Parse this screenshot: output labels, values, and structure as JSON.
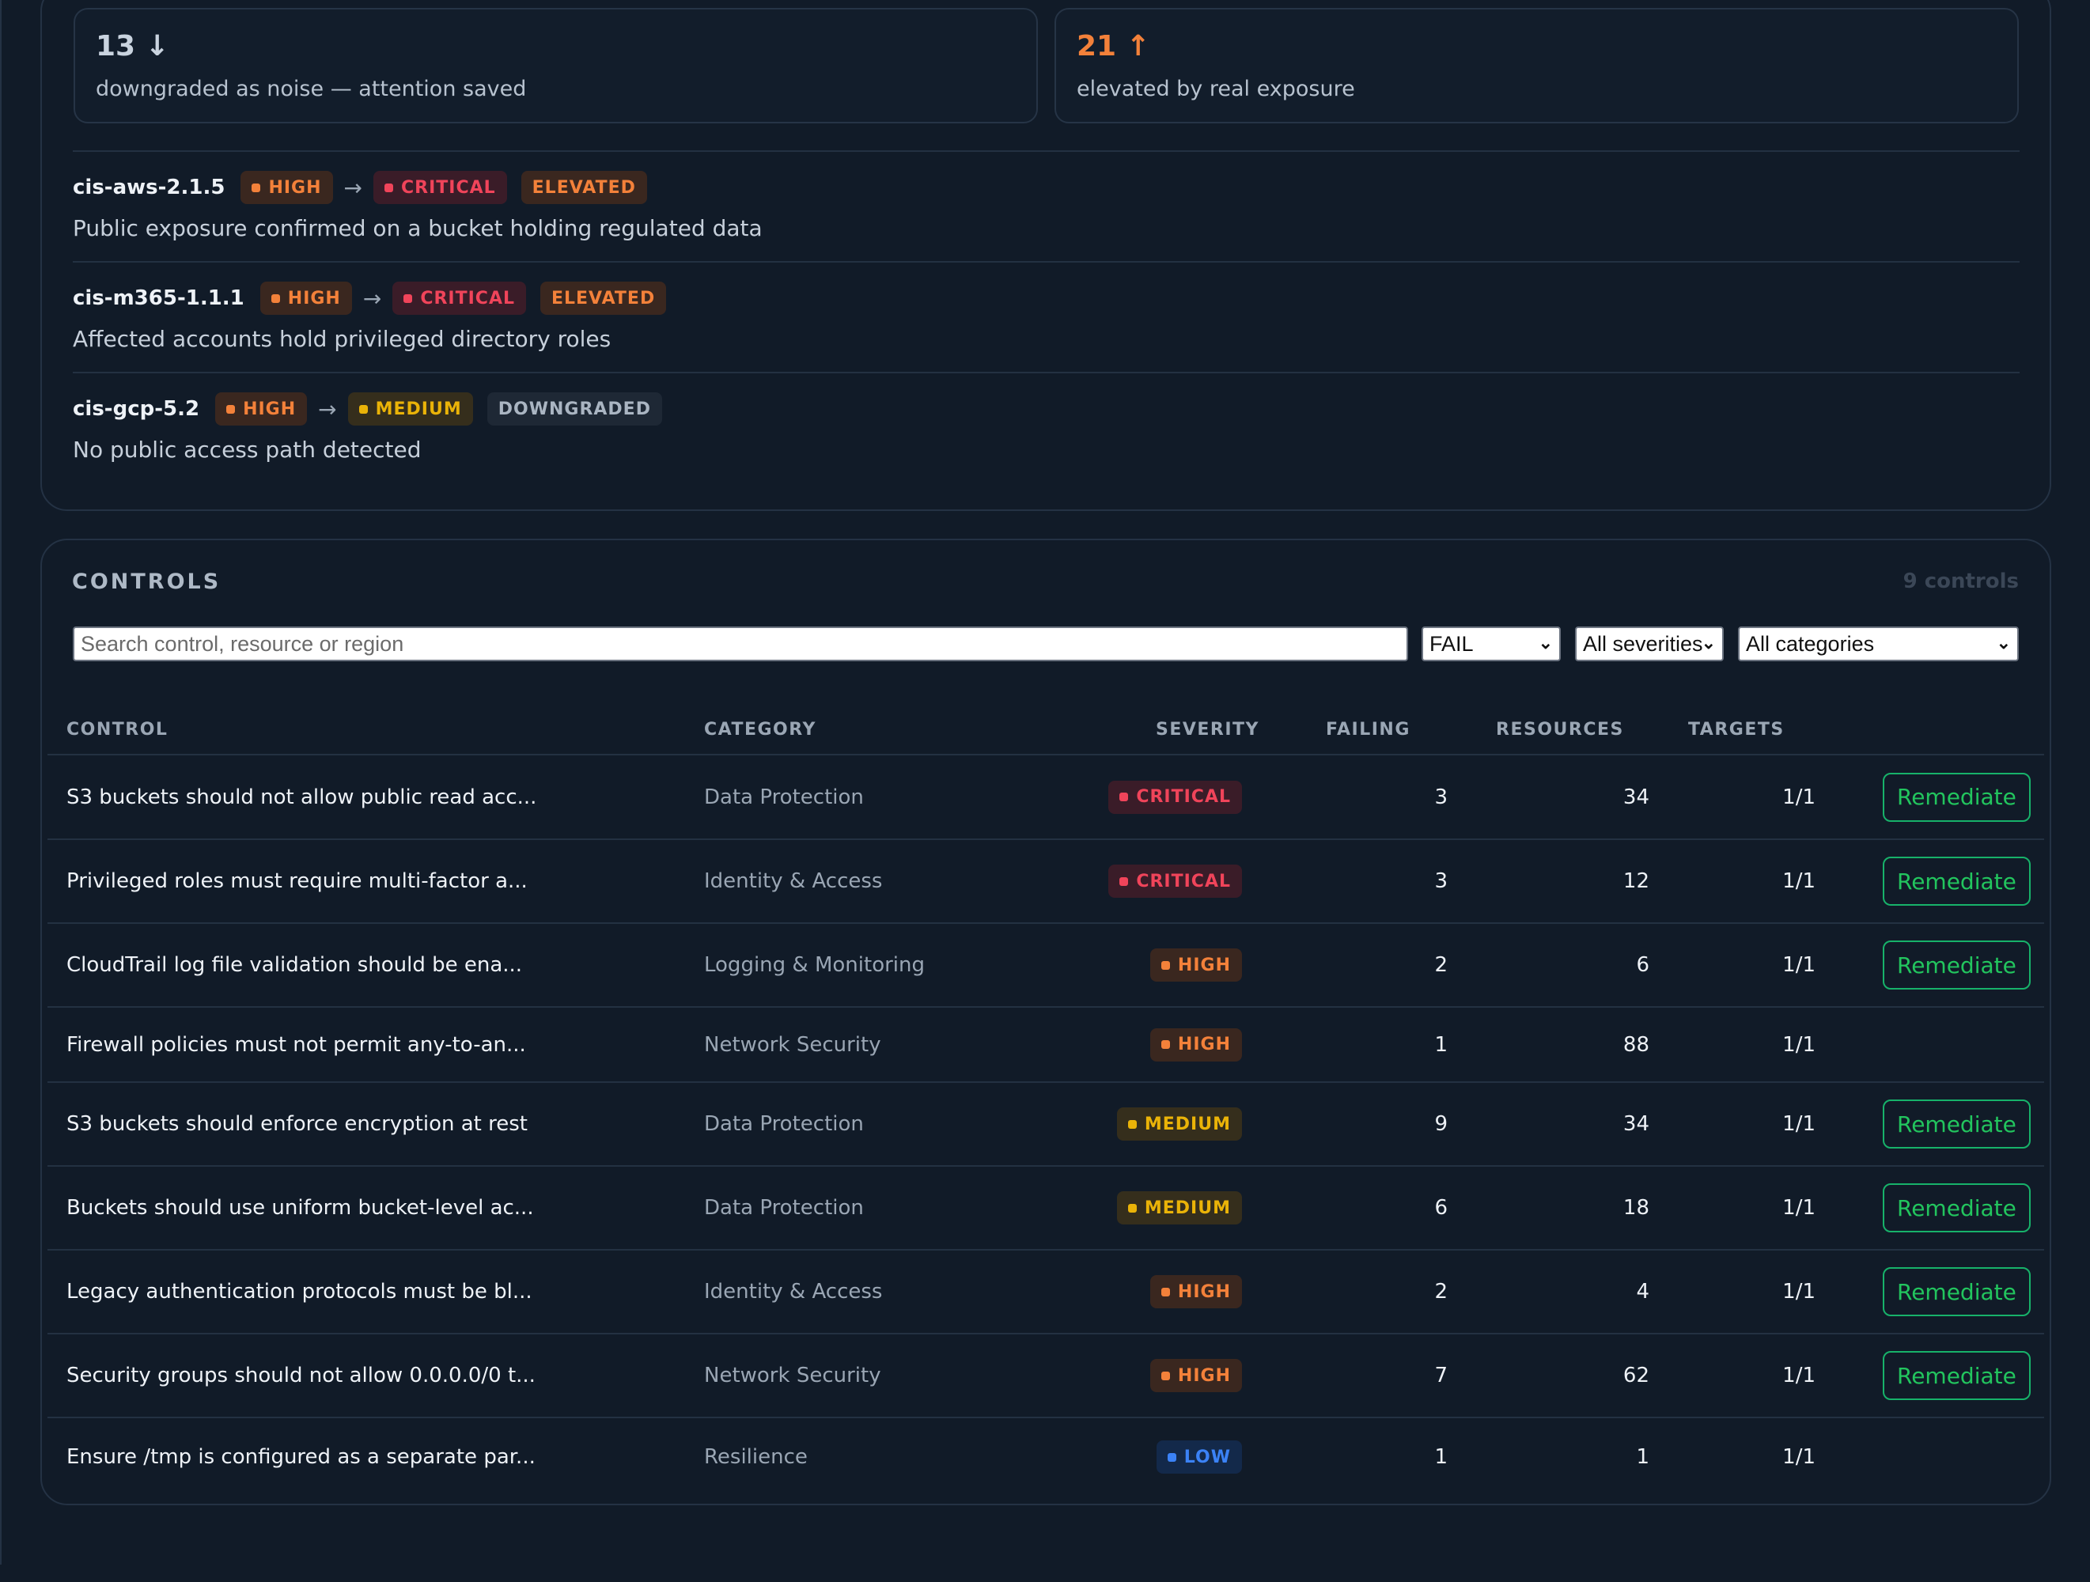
{
  "summary": {
    "downgraded": {
      "value": "13 ↓",
      "label": "downgraded as noise — attention saved"
    },
    "elevated": {
      "value": "21 ↑",
      "label": "elevated by real exposure"
    }
  },
  "adjustments": [
    {
      "id": "cis-aws-2.1.5",
      "from": "HIGH",
      "to": "CRITICAL",
      "change": "ELEVATED",
      "reason": "Public exposure confirmed on a bucket holding regulated data"
    },
    {
      "id": "cis-m365-1.1.1",
      "from": "HIGH",
      "to": "CRITICAL",
      "change": "ELEVATED",
      "reason": "Affected accounts hold privileged directory roles"
    },
    {
      "id": "cis-gcp-5.2",
      "from": "HIGH",
      "to": "MEDIUM",
      "change": "DOWNGRADED",
      "reason": "No public access path detected"
    }
  ],
  "arrow": "→",
  "controls": {
    "title": "CONTROLS",
    "count": "9 controls",
    "search_placeholder": "Search control, resource or region",
    "filters": {
      "status": "FAIL",
      "severity": "All severities",
      "category": "All categories"
    },
    "columns": {
      "control": "CONTROL",
      "category": "CATEGORY",
      "severity": "SEVERITY",
      "failing": "FAILING",
      "resources": "RESOURCES",
      "targets": "TARGETS"
    },
    "remediate_label": "Remediate",
    "rows": [
      {
        "control": "S3 buckets should not allow public read acc...",
        "category": "Data Protection",
        "severity": "CRITICAL",
        "failing": "3",
        "resources": "34",
        "targets": "1/1",
        "remediate": true
      },
      {
        "control": "Privileged roles must require multi-factor a...",
        "category": "Identity & Access",
        "severity": "CRITICAL",
        "failing": "3",
        "resources": "12",
        "targets": "1/1",
        "remediate": true
      },
      {
        "control": "CloudTrail log file validation should be ena...",
        "category": "Logging & Monitoring",
        "severity": "HIGH",
        "failing": "2",
        "resources": "6",
        "targets": "1/1",
        "remediate": true
      },
      {
        "control": "Firewall policies must not permit any-to-an...",
        "category": "Network Security",
        "severity": "HIGH",
        "failing": "1",
        "resources": "88",
        "targets": "1/1",
        "remediate": false
      },
      {
        "control": "S3 buckets should enforce encryption at rest",
        "category": "Data Protection",
        "severity": "MEDIUM",
        "failing": "9",
        "resources": "34",
        "targets": "1/1",
        "remediate": true
      },
      {
        "control": "Buckets should use uniform bucket-level ac...",
        "category": "Data Protection",
        "severity": "MEDIUM",
        "failing": "6",
        "resources": "18",
        "targets": "1/1",
        "remediate": true
      },
      {
        "control": "Legacy authentication protocols must be bl...",
        "category": "Identity & Access",
        "severity": "HIGH",
        "failing": "2",
        "resources": "4",
        "targets": "1/1",
        "remediate": true
      },
      {
        "control": "Security groups should not allow 0.0.0.0/0 t...",
        "category": "Network Security",
        "severity": "HIGH",
        "failing": "7",
        "resources": "62",
        "targets": "1/1",
        "remediate": true
      },
      {
        "control": "Ensure /tmp is configured as a separate par...",
        "category": "Resilience",
        "severity": "LOW",
        "failing": "1",
        "resources": "1",
        "targets": "1/1",
        "remediate": false
      }
    ]
  },
  "colors": {
    "background": "#111b28",
    "critical": "#f0445a",
    "high": "#f3813a",
    "medium": "#eab308",
    "low": "#3b82f6",
    "action": "#22c55e"
  }
}
